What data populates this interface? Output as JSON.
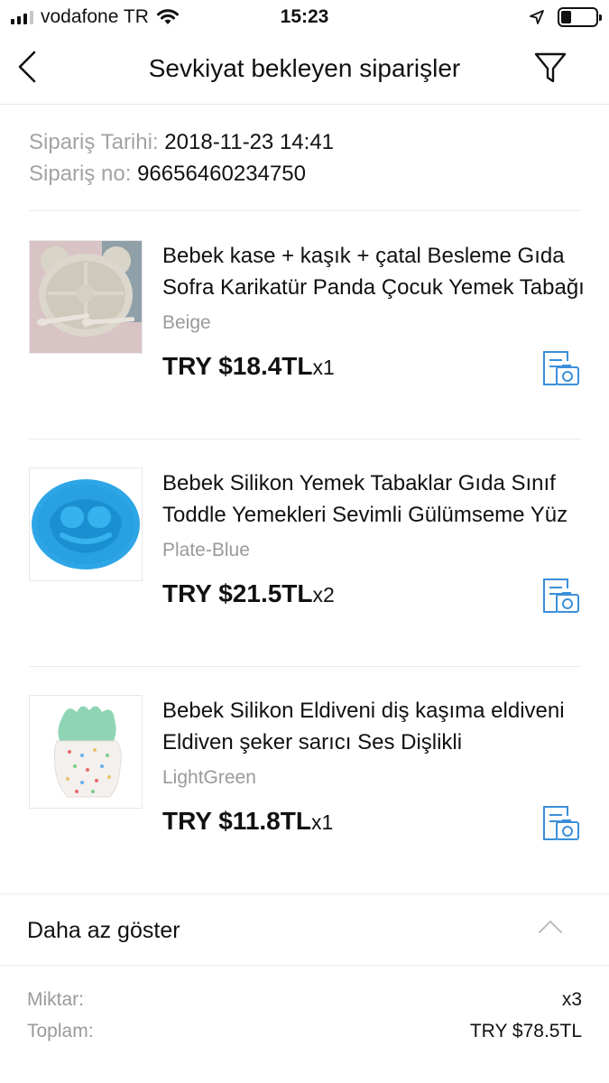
{
  "status_bar": {
    "carrier": "vodafone TR",
    "time": "15:23",
    "battery_level": 0.3
  },
  "nav": {
    "title": "Sevkiyat bekleyen siparişler"
  },
  "order": {
    "date_label": "Sipariş Tarihi:",
    "date_value": "2018-11-23 14:41",
    "number_label": "Sipariş no:",
    "number_value": "96656460234750"
  },
  "products": [
    {
      "title": "Bebek kase + kaşık + çatal Besleme Gıda Sofra Karikatür Panda Çocuk Yemek Tabağı",
      "variant": "Beige",
      "price": "TRY $18.4TL",
      "qty": "x1"
    },
    {
      "title": "Bebek Silikon Yemek Tabaklar Gıda Sınıf Toddle Yemekleri Sevimli Gülümseme Yüz",
      "variant": "Plate-Blue",
      "price": "TRY $21.5TL",
      "qty": "x2"
    },
    {
      "title": "Bebek Silikon Eldiveni diş kaşıma eldiveni Eldiven şeker sarıcı Ses Dişlikli",
      "variant": "LightGreen",
      "price": "TRY $11.8TL",
      "qty": "x1"
    }
  ],
  "show_less": {
    "label": "Daha az göster"
  },
  "summary": {
    "quantity_label": "Miktar:",
    "quantity_value": "x3",
    "total_label": "Toplam:",
    "total_value": "TRY $78.5TL"
  },
  "colors": {
    "accent_icon": "#3b8fd9",
    "muted_text": "#a3a3a3"
  },
  "icons": [
    "signal-icon",
    "wifi-icon",
    "location-arrow-icon",
    "battery-icon",
    "back-arrow-icon",
    "filter-icon",
    "photo-review-icon",
    "chevron-up-icon"
  ]
}
